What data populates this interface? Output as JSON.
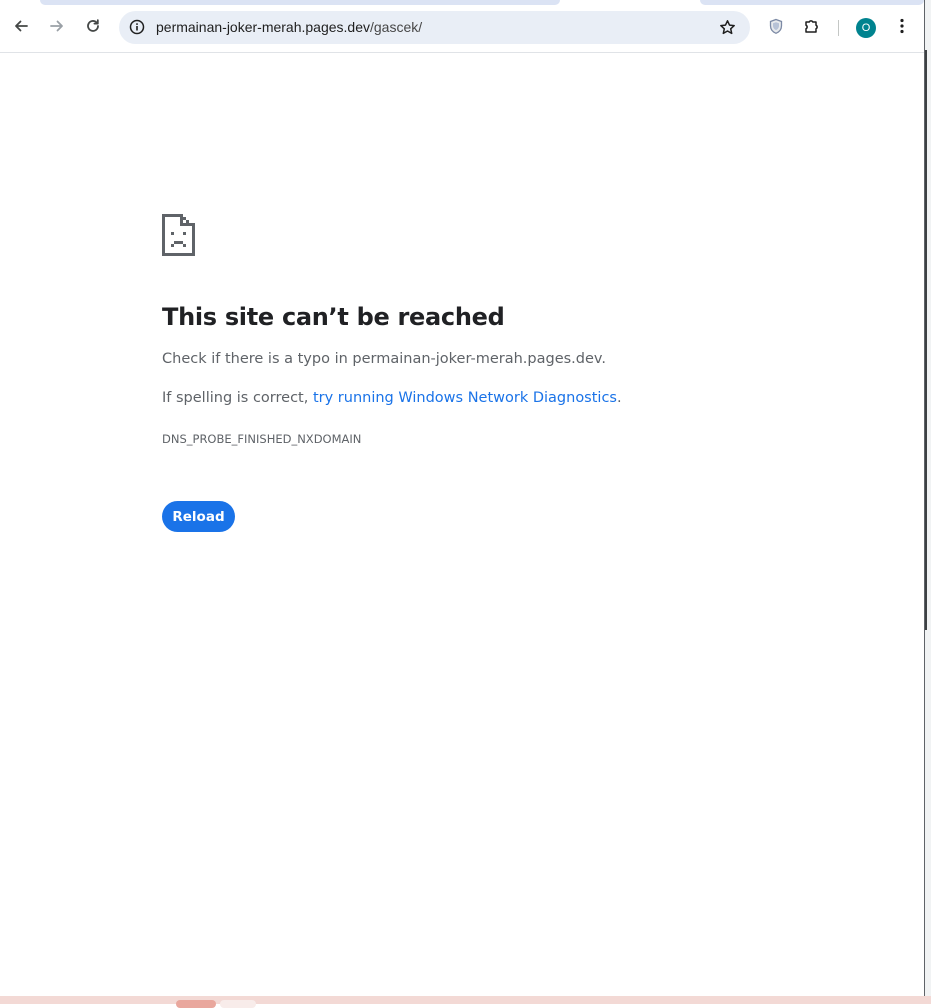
{
  "browser": {
    "url_host": "permainan-joker-merah.pages.dev",
    "url_path": "/gascek/",
    "profile_initial": "O",
    "icons": {
      "back": "arrow-left-icon",
      "forward": "arrow-right-icon",
      "reload": "reload-icon",
      "site_info": "info-icon",
      "bookmark": "star-icon",
      "shield": "shield-icon",
      "extensions": "puzzle-icon",
      "menu": "kebab-menu-icon"
    },
    "colors": {
      "avatar": "#00838f",
      "omnibox": "#e9eef6"
    }
  },
  "error_page": {
    "icon": "sad-page-icon",
    "title": "This site can’t be reached",
    "line1_prefix": "Check if there is a typo in ",
    "line1_host": "permainan-joker-merah.pages.dev",
    "line1_suffix": ".",
    "line2_prefix": "If spelling is correct, ",
    "line2_link": "try running Windows Network Diagnostics",
    "line2_suffix": ".",
    "error_code": "DNS_PROBE_FINISHED_NXDOMAIN",
    "reload_label": "Reload",
    "colors": {
      "title": "#202124",
      "body": "#5f6368",
      "link": "#1a73e8",
      "button": "#1a73e8"
    }
  }
}
